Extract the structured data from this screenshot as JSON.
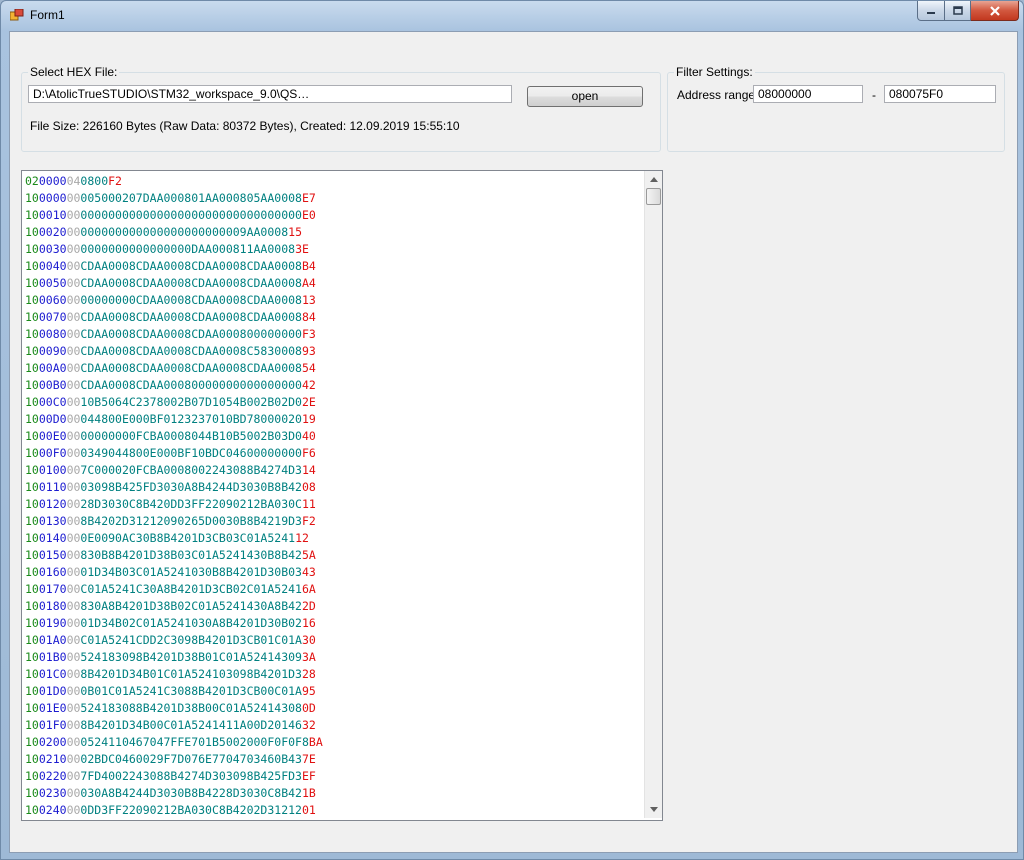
{
  "window": {
    "title": "Form1"
  },
  "hex_group": {
    "legend": "Select HEX File:",
    "path_value": "D:\\AtolicTrueSTUDIO\\STM32_workspace_9.0\\QS…",
    "open_label": "open",
    "file_info": "File Size: 226160 Bytes (Raw Data: 80372 Bytes), Created: 12.09.2019 15:55:10"
  },
  "filter_group": {
    "legend": "Filter Settings:",
    "range_label": "Address range:",
    "start_value": "08000000",
    "dash": "-",
    "end_value": "080075F0"
  },
  "hex_records": [
    {
      "len": "02",
      "addr": "0000",
      "type": "04",
      "data": "0800",
      "chk": "F2"
    },
    {
      "len": "10",
      "addr": "0000",
      "type": "00",
      "data": "005000207DAA000801AA000805AA0008",
      "chk": "E7"
    },
    {
      "len": "10",
      "addr": "0010",
      "type": "00",
      "data": "00000000000000000000000000000000",
      "chk": "E0"
    },
    {
      "len": "10",
      "addr": "0020",
      "type": "00",
      "data": "000000000000000000000009AA0008",
      "chk": "15"
    },
    {
      "len": "10",
      "addr": "0030",
      "type": "00",
      "data": "0000000000000000DAA000811AA0008",
      "chk": "3E"
    },
    {
      "len": "10",
      "addr": "0040",
      "type": "00",
      "data": "CDAA0008CDAA0008CDAA0008CDAA0008",
      "chk": "B4"
    },
    {
      "len": "10",
      "addr": "0050",
      "type": "00",
      "data": "CDAA0008CDAA0008CDAA0008CDAA0008",
      "chk": "A4"
    },
    {
      "len": "10",
      "addr": "0060",
      "type": "00",
      "data": "00000000CDAA0008CDAA0008CDAA0008",
      "chk": "13"
    },
    {
      "len": "10",
      "addr": "0070",
      "type": "00",
      "data": "CDAA0008CDAA0008CDAA0008CDAA0008",
      "chk": "84"
    },
    {
      "len": "10",
      "addr": "0080",
      "type": "00",
      "data": "CDAA0008CDAA0008CDAA000800000000",
      "chk": "F3"
    },
    {
      "len": "10",
      "addr": "0090",
      "type": "00",
      "data": "CDAA0008CDAA0008CDAA0008C5830008",
      "chk": "93"
    },
    {
      "len": "10",
      "addr": "00A0",
      "type": "00",
      "data": "CDAA0008CDAA0008CDAA0008CDAA0008",
      "chk": "54"
    },
    {
      "len": "10",
      "addr": "00B0",
      "type": "00",
      "data": "CDAA0008CDAA00080000000000000000",
      "chk": "42"
    },
    {
      "len": "10",
      "addr": "00C0",
      "type": "00",
      "data": "10B5064C2378002B07D1054B002B02D0",
      "chk": "2E"
    },
    {
      "len": "10",
      "addr": "00D0",
      "type": "00",
      "data": "044800E000BF0123237010BD78000020",
      "chk": "19"
    },
    {
      "len": "10",
      "addr": "00E0",
      "type": "00",
      "data": "00000000FCBA0008044B10B5002B03D0",
      "chk": "40"
    },
    {
      "len": "10",
      "addr": "00F0",
      "type": "00",
      "data": "0349044800E000BF10BDC04600000000",
      "chk": "F6"
    },
    {
      "len": "10",
      "addr": "0100",
      "type": "00",
      "data": "7C000020FCBA0008002243088B4274D3",
      "chk": "14"
    },
    {
      "len": "10",
      "addr": "0110",
      "type": "00",
      "data": "03098B425FD3030A8B4244D3030B8B42",
      "chk": "08"
    },
    {
      "len": "10",
      "addr": "0120",
      "type": "00",
      "data": "28D3030C8B420DD3FF22090212BA030C",
      "chk": "11"
    },
    {
      "len": "10",
      "addr": "0130",
      "type": "00",
      "data": "8B4202D31212090265D0030B8B4219D3",
      "chk": "F2"
    },
    {
      "len": "10",
      "addr": "0140",
      "type": "00",
      "data": "0E0090AC30B8B4201D3CB03C01A5241",
      "chk": "12"
    },
    {
      "len": "10",
      "addr": "0150",
      "type": "00",
      "data": "830B8B4201D38B03C01A5241430B8B42",
      "chk": "5A"
    },
    {
      "len": "10",
      "addr": "0160",
      "type": "00",
      "data": "01D34B03C01A5241030B8B4201D30B03",
      "chk": "43"
    },
    {
      "len": "10",
      "addr": "0170",
      "type": "00",
      "data": "C01A5241C30A8B4201D3CB02C01A5241",
      "chk": "6A"
    },
    {
      "len": "10",
      "addr": "0180",
      "type": "00",
      "data": "830A8B4201D38B02C01A5241430A8B42",
      "chk": "2D"
    },
    {
      "len": "10",
      "addr": "0190",
      "type": "00",
      "data": "01D34B02C01A5241030A8B4201D30B02",
      "chk": "16"
    },
    {
      "len": "10",
      "addr": "01A0",
      "type": "00",
      "data": "C01A5241CDD2C3098B4201D3CB01C01A",
      "chk": "30"
    },
    {
      "len": "10",
      "addr": "01B0",
      "type": "00",
      "data": "524183098B4201D38B01C01A52414309",
      "chk": "3A"
    },
    {
      "len": "10",
      "addr": "01C0",
      "type": "00",
      "data": "8B4201D34B01C01A524103098B4201D3",
      "chk": "28"
    },
    {
      "len": "10",
      "addr": "01D0",
      "type": "00",
      "data": "0B01C01A5241C3088B4201D3CB00C01A",
      "chk": "95"
    },
    {
      "len": "10",
      "addr": "01E0",
      "type": "00",
      "data": "524183088B4201D38B00C01A52414308",
      "chk": "0D"
    },
    {
      "len": "10",
      "addr": "01F0",
      "type": "00",
      "data": "8B4201D34B00C01A5241411A00D20146",
      "chk": "32"
    },
    {
      "len": "10",
      "addr": "0200",
      "type": "00",
      "data": "0524110467047FFE701B5002000F0F0F8",
      "chk": "BA"
    },
    {
      "len": "10",
      "addr": "0210",
      "type": "00",
      "data": "02BDC0460029F7D076E7704703460B43",
      "chk": "7E"
    },
    {
      "len": "10",
      "addr": "0220",
      "type": "00",
      "data": "7FD4002243088B4274D303098B425FD3",
      "chk": "EF"
    },
    {
      "len": "10",
      "addr": "0230",
      "type": "00",
      "data": "030A8B4244D3030B8B4228D3030C8B42",
      "chk": "1B"
    },
    {
      "len": "10",
      "addr": "0240",
      "type": "00",
      "data": "0DD3FF22090212BA030C8B4202D31212",
      "chk": "01"
    }
  ],
  "colors": {
    "length": "#1a8a1a",
    "address": "#1c1cd0",
    "record_type": "#a8a8a8",
    "data": "#008080",
    "checksum": "#e01010"
  },
  "icons": {
    "app": "form-app-icon",
    "minimize": "minimize-icon",
    "maximize": "maximize-icon",
    "close": "close-icon",
    "scroll_up": "chevron-up-icon",
    "scroll_down": "chevron-down-icon"
  }
}
